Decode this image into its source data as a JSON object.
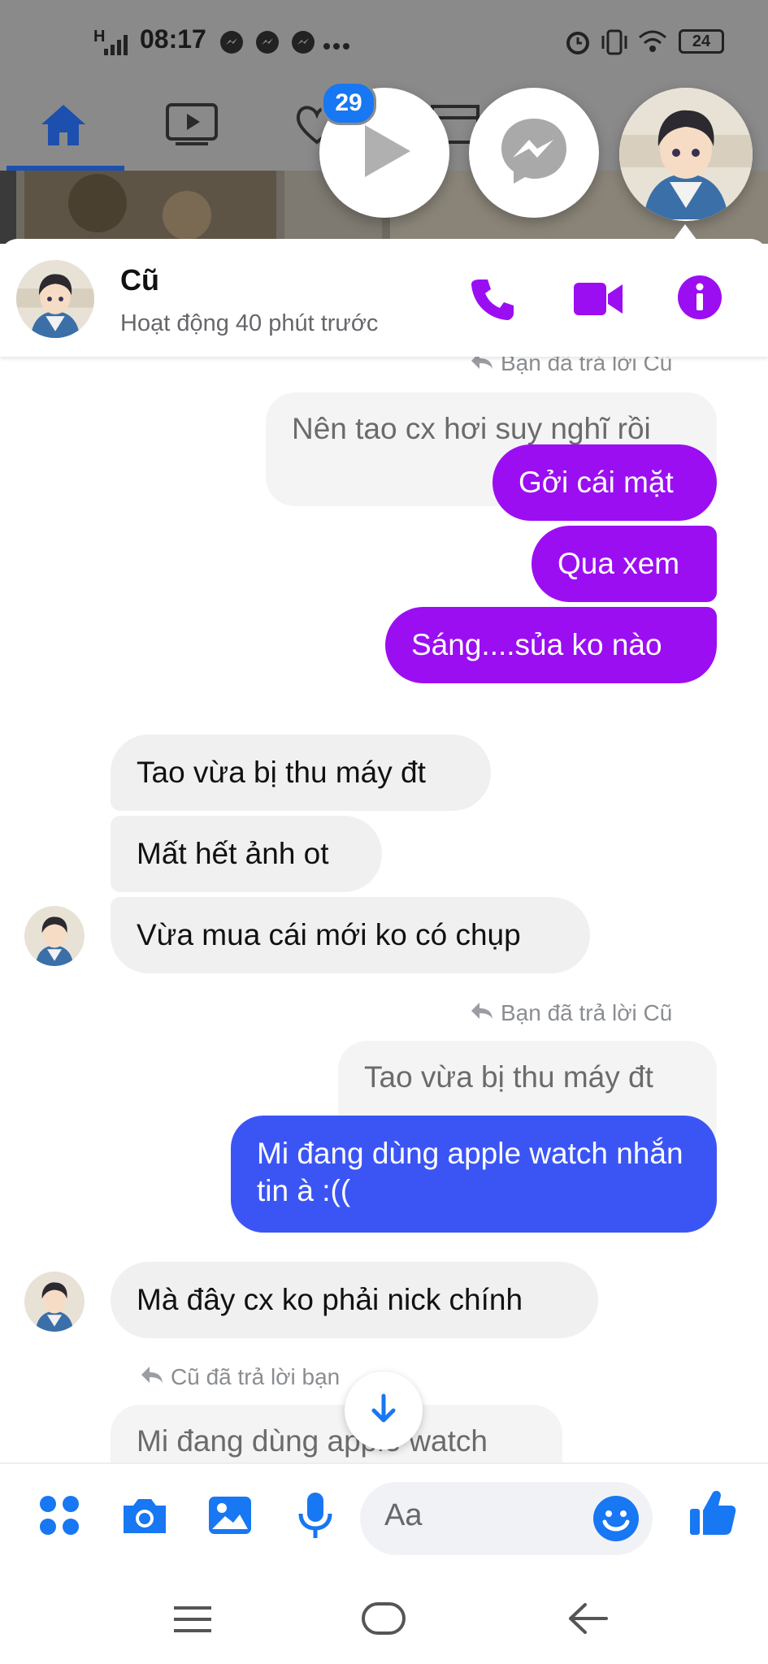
{
  "status_bar": {
    "network": "H",
    "time": "08:17",
    "battery": "24",
    "icons": [
      "messenger-notification-icon",
      "messenger-notification-icon",
      "messenger-notification-icon",
      "more-dots-icon",
      "alarm-icon",
      "vibrate-icon",
      "wifi-icon",
      "battery-icon"
    ]
  },
  "chat_heads": {
    "badge_count": "29",
    "items": [
      "video-play-icon",
      "messenger-icon",
      "contact-avatar"
    ]
  },
  "header": {
    "name": "Cũ",
    "status": "Hoạt động 40 phút trước",
    "actions": [
      "phone-icon",
      "video-call-icon",
      "info-icon"
    ]
  },
  "messages": {
    "reply_top": "Bạn đã trả lời Cũ",
    "quoted_1": "Nên tao cx hơi suy nghĩ rồi",
    "out_1": "Gởi cái mặt",
    "out_2": "Qua xem",
    "out_3": "Sáng....sủa ko nào",
    "in_1": "Tao vừa bị thu máy đt",
    "in_2": "Mất hết ảnh ot",
    "in_3": "Vừa mua cái mới ko có chụp",
    "reply_2": "Bạn đã trả lời Cũ",
    "quoted_2": "Tao vừa bị thu máy đt",
    "out_4": "Mi đang dùng apple watch nhắn tin à :((",
    "in_4": "Mà đây cx ko phải nick chính",
    "reply_3": "Cũ đã trả lời bạn",
    "quoted_3": "Mi đang dùng apple watch"
  },
  "composer": {
    "placeholder": "Aa",
    "icons": [
      "apps-icon",
      "camera-icon",
      "image-icon",
      "microphone-icon",
      "emoji-icon",
      "like-icon"
    ]
  },
  "colors": {
    "accent_purple": "#9b0ef2",
    "accent_blue": "#3b55f5",
    "messenger_blue": "#1877f2"
  }
}
